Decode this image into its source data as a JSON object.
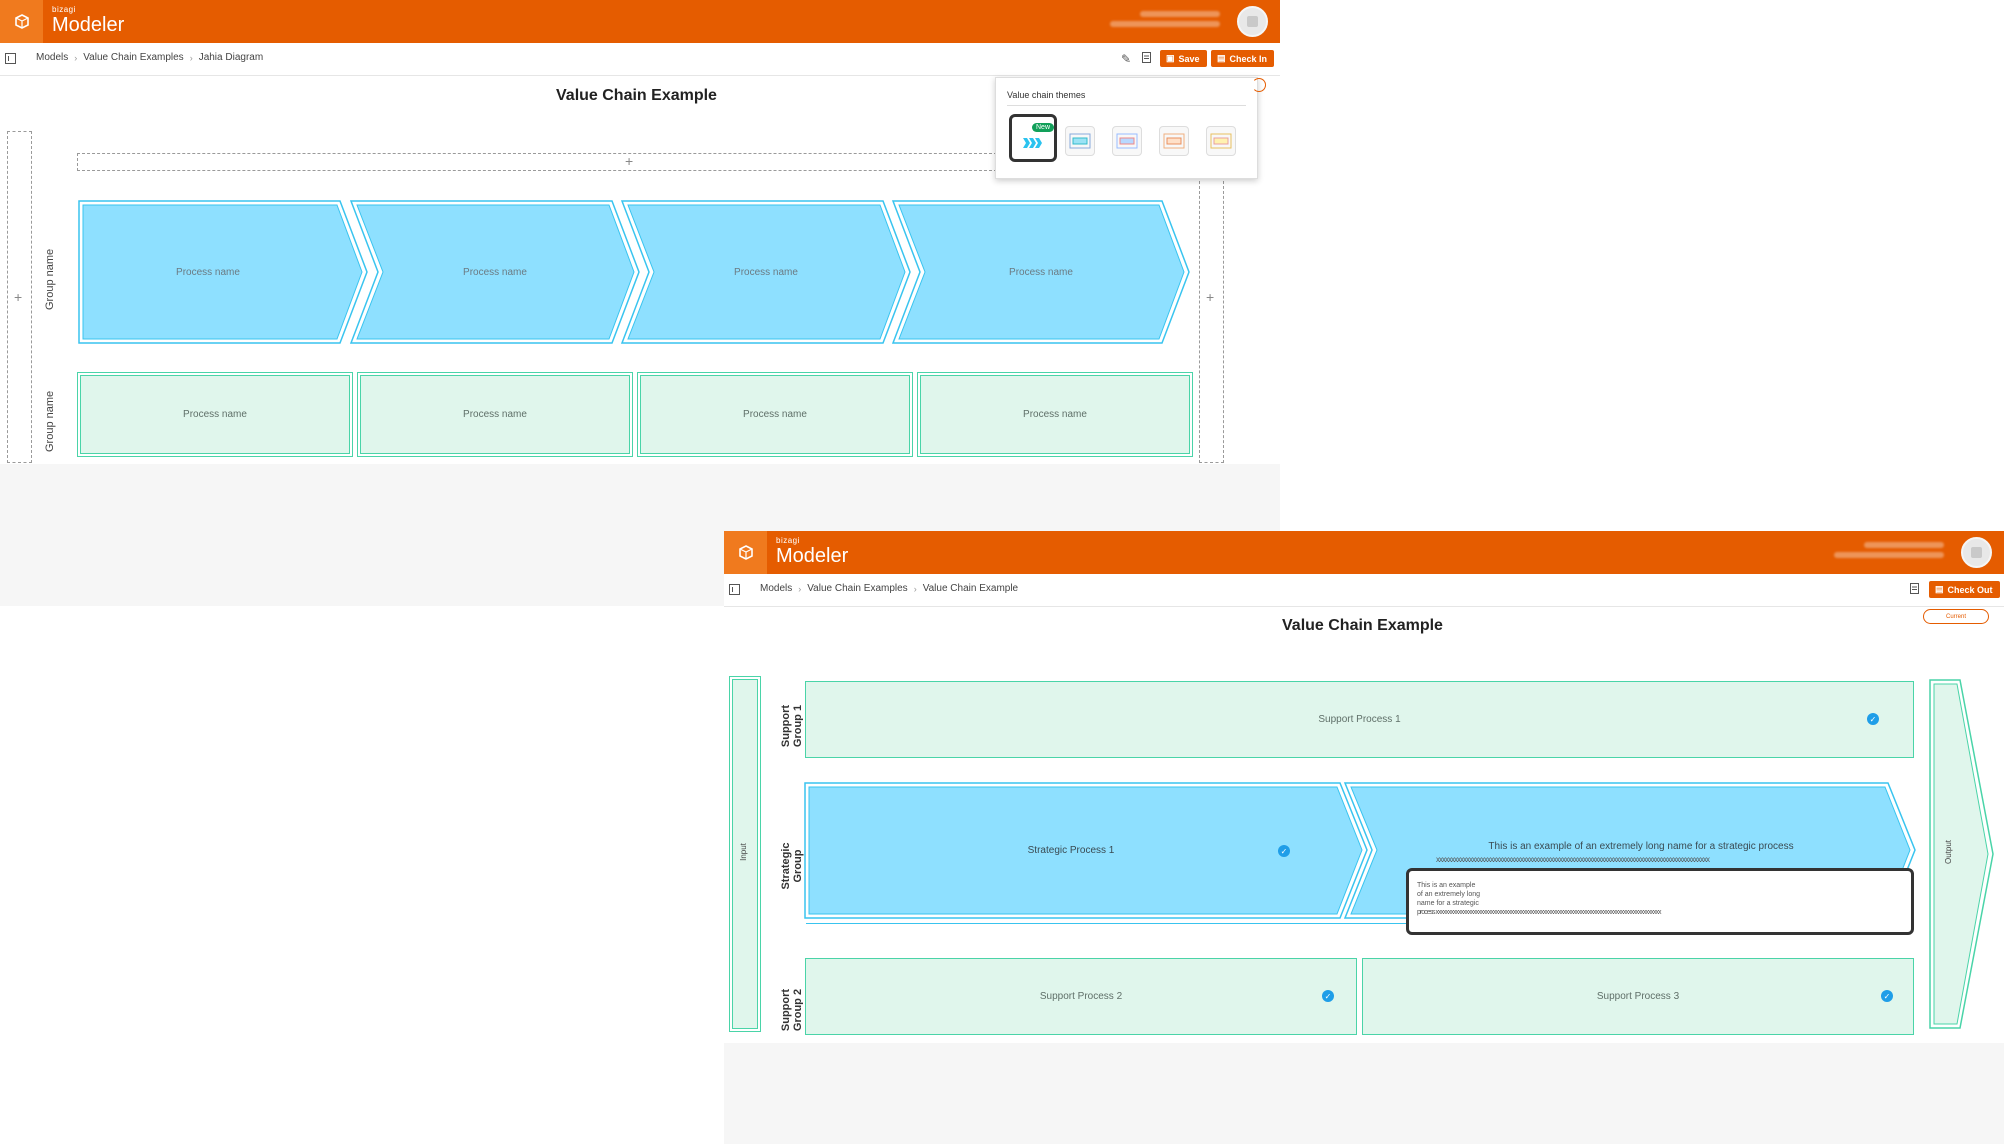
{
  "app": {
    "brand_small": "bizagi",
    "brand_main": "Modeler"
  },
  "window1": {
    "breadcrumb": [
      "Models",
      "Value Chain Examples",
      "Jahia Diagram"
    ],
    "toolbar": {
      "save_label": "Save",
      "check_in_label": "Check In"
    },
    "title": "Value Chain Example",
    "group_label": "Group name",
    "strategic_processes": [
      "Process name",
      "Process name",
      "Process name",
      "Process name"
    ],
    "support_processes": [
      "Process name",
      "Process name",
      "Process name",
      "Process name"
    ],
    "themes_popover": {
      "title": "Value chain themes",
      "new_badge": "New",
      "themes": [
        "theme-chevrons",
        "theme-cyan",
        "theme-blue",
        "theme-orange",
        "theme-yellow"
      ]
    }
  },
  "window2": {
    "breadcrumb": [
      "Models",
      "Value Chain Examples",
      "Value Chain Example"
    ],
    "toolbar": {
      "check_out_label": "Check Out"
    },
    "title": "Value Chain Example",
    "version_pill": "Current",
    "input_label": "Input",
    "output_label": "Output",
    "support_group_1": {
      "label": "Support Group 1",
      "process": "Support Process 1"
    },
    "strategic_group": {
      "label": "Strategic Group",
      "process_1": "Strategic Process 1",
      "process_2_line1": "This is an example of an extremely long name for a strategic process",
      "process_2_line2": "xxxxxxxxxxxxxxxxxxxxxxxxxxxxxxxxxxxxxxxxxxxxxxxxxxxxxxxxxxxxxxxxxxxxxxxxxxxxxxxxxxxxxxxxxxx",
      "edit_text_1": "This is an example",
      "edit_text_2": "of an extremely long",
      "edit_text_3": "name for a strategic",
      "edit_text_4": "process xxxxxxxxxxxxxxxxxxxxxxxxxxxxxxxxxxxxxxxxxxxxxxxxxxxxxxxxxxxxxxxxxxxxxxxxxxxxxxxxxxxxxxxxxx"
    },
    "support_group_2": {
      "label": "Support Group 2",
      "process_1": "Support Process 2",
      "process_2": "Support Process 3"
    }
  },
  "colors": {
    "brand_orange": "#e55c00",
    "strategic_fill": "#8ee0ff",
    "strategic_stroke": "#39c4ef",
    "support_fill": "#e0f6ec",
    "support_stroke": "#4ad4a8",
    "check_blue": "#1f9ee8"
  },
  "icons": [
    "box-logo-icon",
    "sidebar-toggle-icon",
    "pencil-icon",
    "document-icon",
    "save-icon",
    "check-in-icon",
    "check-out-icon",
    "plus-icon",
    "checkmark-icon"
  ]
}
